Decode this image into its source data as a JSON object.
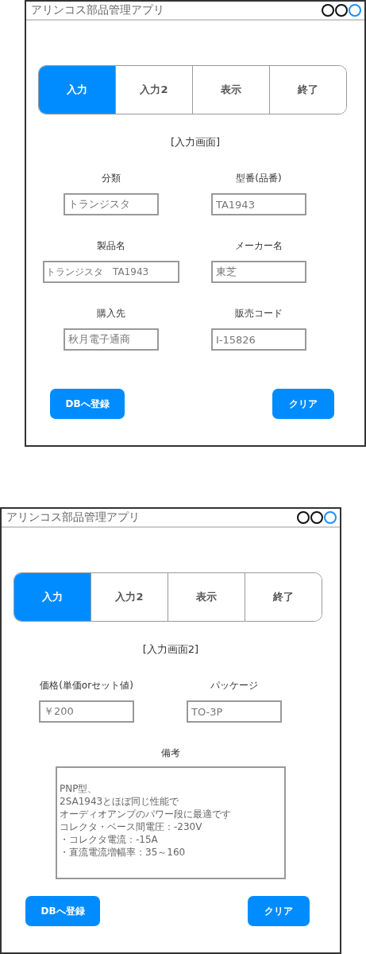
{
  "windows": [
    {
      "title": "アリンコス部品管理アプリ",
      "tabs": [
        {
          "label": "入力",
          "selected": true
        },
        {
          "label": "入力2",
          "selected": false
        },
        {
          "label": "表示",
          "selected": false
        },
        {
          "label": "終了",
          "selected": false
        }
      ],
      "heading": "[入力画面]",
      "fields": [
        {
          "label": "分類",
          "value": "トランジスタ"
        },
        {
          "label": "型番(品番)",
          "value": "TA1943"
        },
        {
          "label": "製品名",
          "value": "トランジスタ　TA1943"
        },
        {
          "label": "メーカー名",
          "value": "東芝"
        },
        {
          "label": "購入先",
          "value": "秋月電子通商"
        },
        {
          "label": "販売コード",
          "value": "I-15826"
        }
      ],
      "buttons": [
        "DBへ登録",
        "クリア"
      ]
    },
    {
      "title": "アリンコス部品管理アプリ",
      "tabs": [
        {
          "label": "入力",
          "selected": true
        },
        {
          "label": "入力2",
          "selected": false
        },
        {
          "label": "表示",
          "selected": false
        },
        {
          "label": "終了",
          "selected": false
        }
      ],
      "heading": "[入力画面2]",
      "fields": [
        {
          "label": "価格(単価orセット値)",
          "value": "￥200"
        },
        {
          "label": "パッケージ",
          "value": "TO-3P"
        }
      ],
      "note": {
        "label": "備考",
        "lines": [
          "PNP型、",
          "2SA1943とほぼ同じ性能で",
          "オーディオアンプのパワー段に最適です",
          "コレクタ・ベース間電圧：-230V",
          "・コレクタ電流：-15A",
          "・直流電流増幅率：35～160"
        ]
      },
      "buttons": [
        "DBへ登録",
        "クリア"
      ]
    }
  ]
}
